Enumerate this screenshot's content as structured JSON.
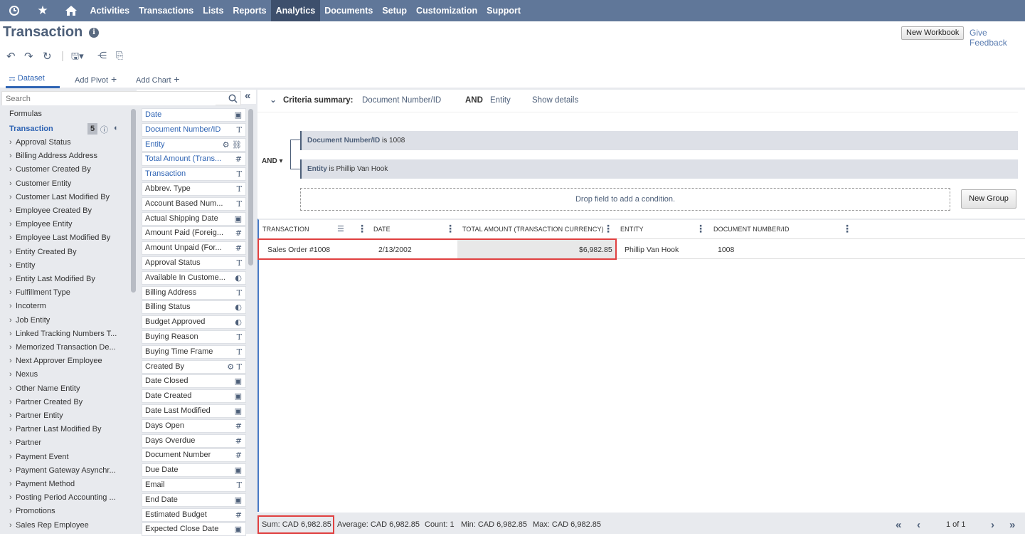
{
  "nav": {
    "items": [
      {
        "label": "Activities"
      },
      {
        "label": "Transactions"
      },
      {
        "label": "Lists"
      },
      {
        "label": "Reports"
      },
      {
        "label": "Analytics"
      },
      {
        "label": "Documents"
      },
      {
        "label": "Setup"
      },
      {
        "label": "Customization"
      },
      {
        "label": "Support"
      }
    ],
    "active": "Analytics"
  },
  "header": {
    "title": "Transaction",
    "new_workbook": "New Workbook",
    "give_feedback": "Give Feedback"
  },
  "tabs": {
    "dataset": "Dataset",
    "add_pivot": "Add Pivot",
    "add_chart": "Add Chart"
  },
  "search": {
    "placeholder": "Search"
  },
  "left": {
    "formulas": "Formulas",
    "record": "Transaction",
    "count": "5",
    "items": [
      "Approval Status",
      "Billing Address Address",
      "Customer Created By",
      "Customer Entity",
      "Customer Last Modified By",
      "Employee Created By",
      "Employee Entity",
      "Employee Last Modified By",
      "Entity Created By",
      "Entity",
      "Entity Last Modified By",
      "Fulfillment Type",
      "Incoterm",
      "Job Entity",
      "Linked Tracking Numbers T...",
      "Memorized Transaction De...",
      "Next Approver Employee",
      "Nexus",
      "Other Name Entity",
      "Partner Created By",
      "Partner Entity",
      "Partner Last Modified By",
      "Partner",
      "Payment Event",
      "Payment Gateway Asynchr...",
      "Payment Method",
      "Posting Period Accounting ...",
      "Promotions",
      "Sales Rep Employee"
    ]
  },
  "fields": [
    {
      "name": "Date",
      "type": "▣",
      "sel": true
    },
    {
      "name": "Document Number/ID",
      "type": "T",
      "sel": true
    },
    {
      "name": "Entity",
      "type": "⚙ ⛓",
      "sel": true
    },
    {
      "name": "Total Amount (Trans...",
      "type": "#",
      "sel": true
    },
    {
      "name": "Transaction",
      "type": "T",
      "sel": true
    },
    {
      "name": "Abbrev. Type",
      "type": "T"
    },
    {
      "name": "Account Based Num...",
      "type": "T"
    },
    {
      "name": "Actual Shipping Date",
      "type": "▣"
    },
    {
      "name": "Amount Paid (Foreig...",
      "type": "#"
    },
    {
      "name": "Amount Unpaid (For...",
      "type": "#"
    },
    {
      "name": "Approval Status",
      "type": "T"
    },
    {
      "name": "Available In Custome...",
      "type": "◐"
    },
    {
      "name": "Billing Address",
      "type": "T"
    },
    {
      "name": "Billing Status",
      "type": "◐"
    },
    {
      "name": "Budget Approved",
      "type": "◐"
    },
    {
      "name": "Buying Reason",
      "type": "T"
    },
    {
      "name": "Buying Time Frame",
      "type": "T"
    },
    {
      "name": "Created By",
      "type": "⚙ T"
    },
    {
      "name": "Date Closed",
      "type": "▣"
    },
    {
      "name": "Date Created",
      "type": "▣"
    },
    {
      "name": "Date Last Modified",
      "type": "▣"
    },
    {
      "name": "Days Open",
      "type": "#"
    },
    {
      "name": "Days Overdue",
      "type": "#"
    },
    {
      "name": "Document Number",
      "type": "#"
    },
    {
      "name": "Due Date",
      "type": "▣"
    },
    {
      "name": "Email",
      "type": "T"
    },
    {
      "name": "End Date",
      "type": "▣"
    },
    {
      "name": "Estimated Budget",
      "type": "#"
    },
    {
      "name": "Expected Close Date",
      "type": "▣"
    }
  ],
  "criteria": {
    "label": "Criteria summary:",
    "c1": "Document Number/ID",
    "and": "AND",
    "c2": "Entity",
    "show": "Show details",
    "cond1_field": "Document Number/ID",
    "cond1_rest": " is 1008",
    "cond2_field": "Entity",
    "cond2_rest": " is Phillip Van Hook",
    "and_op": "AND",
    "drop": "Drop field to add a condition.",
    "new_group": "New Group"
  },
  "grid": {
    "headers": [
      "TRANSACTION",
      "DATE",
      "TOTAL AMOUNT (TRANSACTION CURRENCY)",
      "ENTITY",
      "DOCUMENT NUMBER/ID"
    ],
    "row": [
      "Sales Order #1008",
      "2/13/2002",
      "$6,982.85",
      "Phillip Van Hook",
      "1008"
    ]
  },
  "footer": {
    "sum": "Sum: CAD 6,982.85",
    "avg": "Average: CAD 6,982.85",
    "count": "Count: 1",
    "min": "Min: CAD 6,982.85",
    "max": "Max: CAD 6,982.85",
    "page": "1 of 1"
  }
}
